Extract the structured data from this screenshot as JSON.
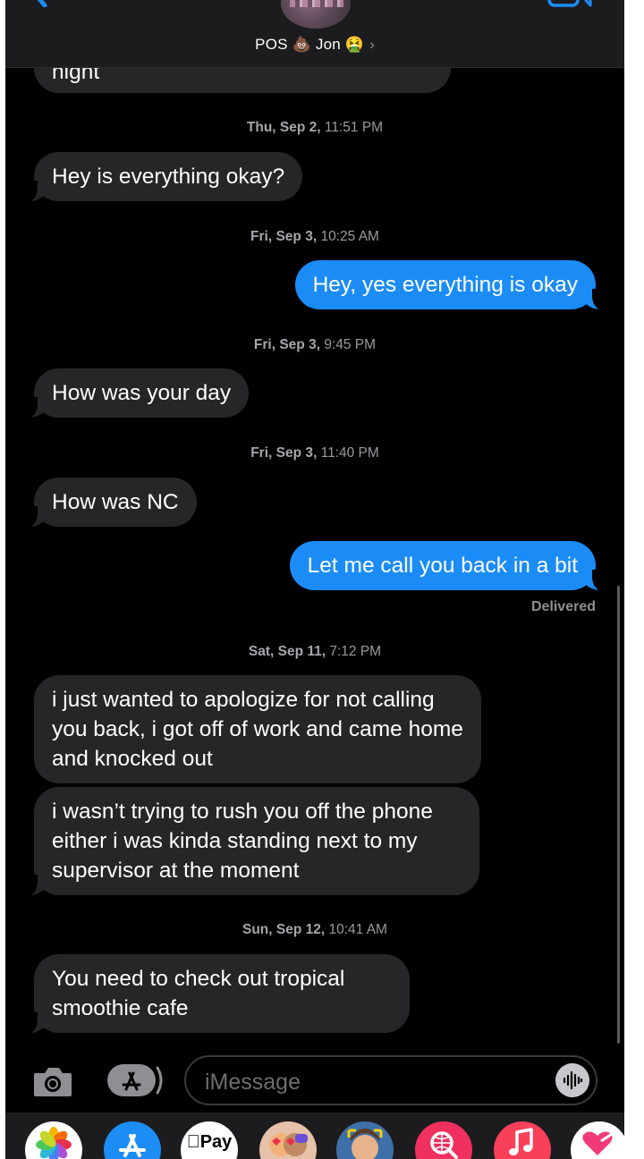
{
  "header": {
    "contact_name": "POS 💩 Jon 🤮",
    "chevron": "›",
    "icons": [
      "back-chevron-icon",
      "video-camera-icon"
    ]
  },
  "messages": [
    {
      "type": "incoming",
      "text": "night"
    },
    {
      "type": "timestamp",
      "day": "Thu, Sep 2,",
      "time": "11:51 PM"
    },
    {
      "type": "incoming",
      "text": "Hey is everything okay?"
    },
    {
      "type": "timestamp",
      "day": "Fri, Sep 3,",
      "time": "10:25 AM"
    },
    {
      "type": "outgoing",
      "text": "Hey, yes everything is okay"
    },
    {
      "type": "timestamp",
      "day": "Fri, Sep 3,",
      "time": "9:45 PM"
    },
    {
      "type": "incoming",
      "text": "How was your day"
    },
    {
      "type": "timestamp",
      "day": "Fri, Sep 3,",
      "time": "11:40 PM"
    },
    {
      "type": "incoming",
      "text": "How was NC"
    },
    {
      "type": "outgoing",
      "text": "Let me call you back in a bit"
    },
    {
      "type": "status",
      "text": "Delivered"
    },
    {
      "type": "timestamp",
      "day": "Sat, Sep 11,",
      "time": "7:12 PM"
    },
    {
      "type": "incoming",
      "text": "i just wanted to apologize for not calling you back, i got off of work and came home and knocked out"
    },
    {
      "type": "incoming",
      "text": "i wasn’t trying to rush you off the phone either i was kinda standing next to my supervisor at the moment"
    },
    {
      "type": "timestamp",
      "day": "Sun, Sep 12,",
      "time": "10:41 AM"
    },
    {
      "type": "incoming",
      "text": "You need to check out tropical smoothie cafe"
    }
  ],
  "composer": {
    "placeholder": "iMessage",
    "icons": [
      "camera-icon",
      "app-store-icon",
      "audio-message-icon"
    ]
  },
  "app_drawer": {
    "apple_pay_label": "Pay",
    "apps": [
      "photos-app-icon",
      "app-store-app-icon",
      "apple-pay-app-icon",
      "memoji-stickers-app-icon",
      "memoji-app-icon",
      "web-images-app-icon",
      "music-app-icon",
      "heart-app-icon"
    ]
  },
  "colors": {
    "incoming_bubble": "#262629",
    "outgoing_bubble": "#1b8cf6",
    "background": "#000000",
    "timestamp": "#9a9aa0"
  }
}
